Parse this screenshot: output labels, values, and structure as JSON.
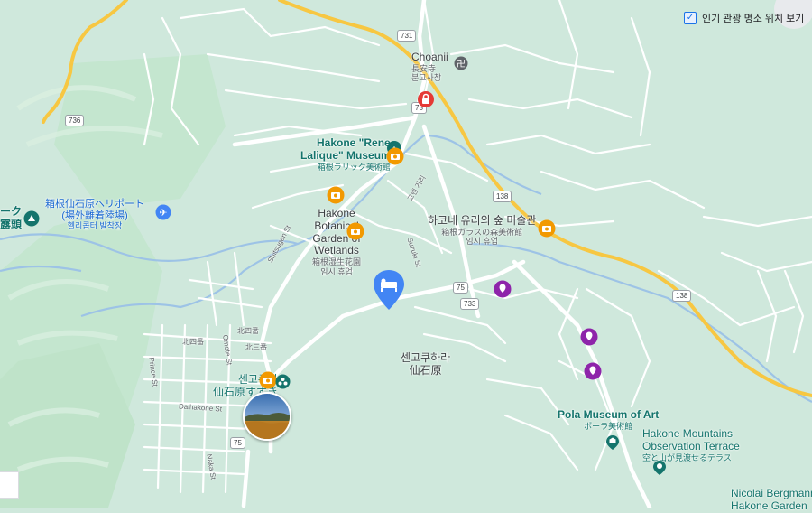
{
  "layer_toggle": {
    "label": "인기 관광 명소 위치 보기",
    "checked": true
  },
  "routes": [
    "731",
    "75",
    "736",
    "138",
    "138",
    "75",
    "733",
    "75"
  ],
  "places": {
    "choanji": {
      "name": "Choanii",
      "sub1": "長安寺",
      "sub2": "분고사창"
    },
    "lalique": {
      "name1": "Hakone \"Rene",
      "name2": "Lalique\" Museum",
      "sub": "箱根ラリック美術館"
    },
    "botanical": {
      "name1": "Hakone",
      "name2": "Botanical",
      "name3": "Garden of",
      "name4": "Wetlands",
      "sub1": "箱根湿生花園",
      "sub2": "임시 휴업"
    },
    "glass": {
      "name": "하코네 유리의 숲 미술관",
      "sub1": "箱根ガラスの森美術館",
      "sub2": "임시 휴업"
    },
    "heliport": {
      "name1": "箱根仙石原ヘリポート",
      "name2": "(場外離着陸場)",
      "sub": "헬리콥터 발착장"
    },
    "left_edge": {
      "name1": "ーク",
      "name2": "露頭"
    },
    "sengokuhara_area": {
      "name1": "센고쿠하라",
      "name2": "仙石原"
    },
    "sengokuhara_poi": {
      "name1": "센고쿠하",
      "name2": "仙石原すすき"
    },
    "pola": {
      "name": "Pola Museum of Art",
      "sub": "ポーラ美術館"
    },
    "observation": {
      "name1": "Hakone Mountains",
      "name2": "Observation Terrace",
      "sub": "空と山が見渡せるテラス"
    },
    "nicolai": {
      "name1": "Nicolai Bergmann",
      "name2": "Hakone Garden"
    }
  },
  "streets": {
    "shitsugen": "Shitsugen St",
    "suzuki": "Suzuki St",
    "goten": "고텐 거리",
    "prince": "Prince St",
    "omote": "Omote St",
    "daihakone": "Daihakone St",
    "naka": "Naka St",
    "kita4": "北四番",
    "kita3": "北三番",
    "kita4b": "北四番"
  },
  "colors": {
    "land": "#cfe8dc",
    "forest": "#bfe3cb",
    "road": "#ffffff",
    "highway": "#f7c742",
    "water": "#9dc3e6",
    "poi_teal": "#14746c",
    "poi_orange": "#f29900",
    "poi_purple": "#8e24aa",
    "poi_red": "#e53935",
    "hotel_blue": "#4285f4"
  },
  "icons": [
    "hotel-icon",
    "museum-icon",
    "temple-icon",
    "heliport-icon",
    "viewpoint-icon",
    "park-icon",
    "lock-icon",
    "checkbox-icon"
  ]
}
